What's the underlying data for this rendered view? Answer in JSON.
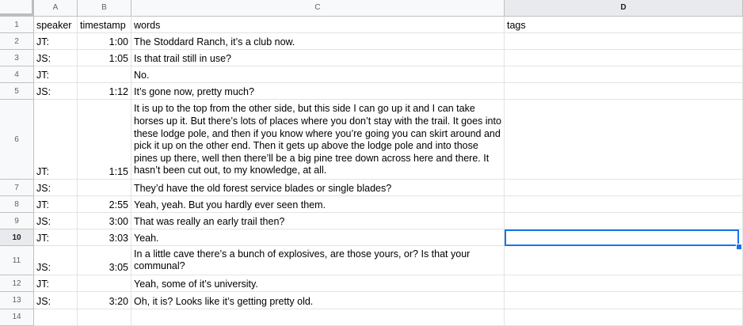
{
  "columns": [
    "A",
    "B",
    "C",
    "D"
  ],
  "header": {
    "speaker": "speaker",
    "timestamp": "timestamp",
    "words": "words",
    "tags": "tags"
  },
  "rows": [
    {
      "num": "2",
      "speaker": "JT:",
      "timestamp": "1:00",
      "words": "The Stoddard Ranch, it’s a club now.",
      "tags": ""
    },
    {
      "num": "3",
      "speaker": "JS:",
      "timestamp": "1:05",
      "words": "Is that trail still in use?",
      "tags": ""
    },
    {
      "num": "4",
      "speaker": "JT:",
      "timestamp": "",
      "words": "No.",
      "tags": ""
    },
    {
      "num": "5",
      "speaker": "JS:",
      "timestamp": "1:12",
      "words": "It’s gone now, pretty much?",
      "tags": ""
    },
    {
      "num": "6",
      "speaker": "JT:",
      "timestamp": "1:15",
      "words": "It is up to the top from the other side, but this side I can go up it and I can take horses up it. But there’s lots of places where you don’t stay with the trail. It goes into these lodge pole, and then if you know where you’re going you can skirt around and pick it up on the other end. Then it gets up above the lodge pole and into those pines up there, well then there’ll be a big pine tree down across here and there. It hasn’t been cut out, to my knowledge, at all.",
      "tags": ""
    },
    {
      "num": "7",
      "speaker": "JS:",
      "timestamp": "",
      "words": "They’d have the old forest service blades or single blades?",
      "tags": ""
    },
    {
      "num": "8",
      "speaker": "JT:",
      "timestamp": "2:55",
      "words": "Yeah, yeah. But you hardly ever seen them.",
      "tags": ""
    },
    {
      "num": "9",
      "speaker": "JS:",
      "timestamp": "3:00",
      "words": "That was really an early trail then?",
      "tags": ""
    },
    {
      "num": "10",
      "speaker": "JT:",
      "timestamp": "3:03",
      "words": "Yeah.",
      "tags": ""
    },
    {
      "num": "11",
      "speaker": "JS:",
      "timestamp": "3:05",
      "words": "In a little cave there’s a bunch of explosives, are those yours, or? Is that your communal?",
      "tags": ""
    },
    {
      "num": "12",
      "speaker": "JT:",
      "timestamp": "",
      "words": "Yeah, some of it’s university.",
      "tags": ""
    },
    {
      "num": "13",
      "speaker": "JS:",
      "timestamp": "3:20",
      "words": "Oh, it is? Looks like it’s getting pretty old.",
      "tags": ""
    },
    {
      "num": "14",
      "speaker": "",
      "timestamp": "",
      "words": "",
      "tags": ""
    }
  ],
  "header_row_num": "1",
  "selected_cell": "D10"
}
